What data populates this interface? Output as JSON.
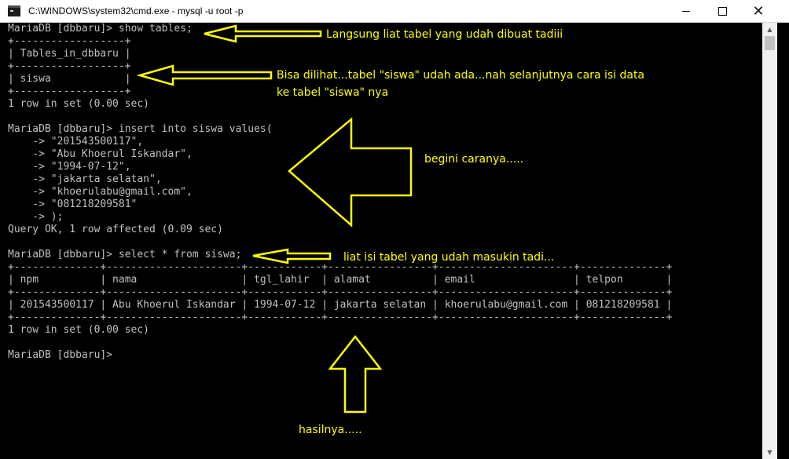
{
  "window": {
    "title": "C:\\WINDOWS\\system32\\cmd.exe - mysql  -u root -p",
    "icon": "console-icon",
    "minimize_glyph": "",
    "maximize_glyph": "",
    "close_glyph": "✕"
  },
  "console": {
    "lines": [
      "MariaDB [dbbaru]> show tables;",
      "+------------------+",
      "| Tables_in_dbbaru |",
      "+------------------+",
      "| siswa            |",
      "+------------------+",
      "1 row in set (0.00 sec)",
      "",
      "MariaDB [dbbaru]> insert into siswa values(",
      "    -> \"201543500117\",",
      "    -> \"Abu Khoerul Iskandar\",",
      "    -> \"1994-07-12\",",
      "    -> \"jakarta selatan\",",
      "    -> \"khoerulabu@gmail.com\",",
      "    -> \"081218209581\"",
      "    -> );",
      "Query OK, 1 row affected (0.09 sec)",
      "",
      "MariaDB [dbbaru]> select * from siswa;",
      "+--------------+----------------------+------------+-----------------+----------------------+--------------+",
      "| npm          | nama                 | tgl_lahir  | alamat          | email                | telpon       |",
      "+--------------+----------------------+------------+-----------------+----------------------+--------------+",
      "| 201543500117 | Abu Khoerul Iskandar | 1994-07-12 | jakarta selatan | khoerulabu@gmail.com | 081218209581 |",
      "+--------------+----------------------+------------+-----------------+----------------------+--------------+",
      "1 row in set (0.00 sec)",
      "",
      "MariaDB [dbbaru]>"
    ]
  },
  "annotations": {
    "a1": "Langsung liat tabel yang udah dibuat tadiii",
    "a2_line1": "Bisa dilihat...tabel \"siswa\" udah ada...nah selanjutnya cara isi data",
    "a2_line2": "ke tabel \"siswa\" nya",
    "a3": "begini caranya.....",
    "a4": "liat isi tabel yang udah masukin tadi...",
    "a5": "hasilnya....."
  },
  "colors": {
    "annotation": "#ffff00",
    "console_text": "#c0c0c0",
    "console_bg": "#000000"
  }
}
